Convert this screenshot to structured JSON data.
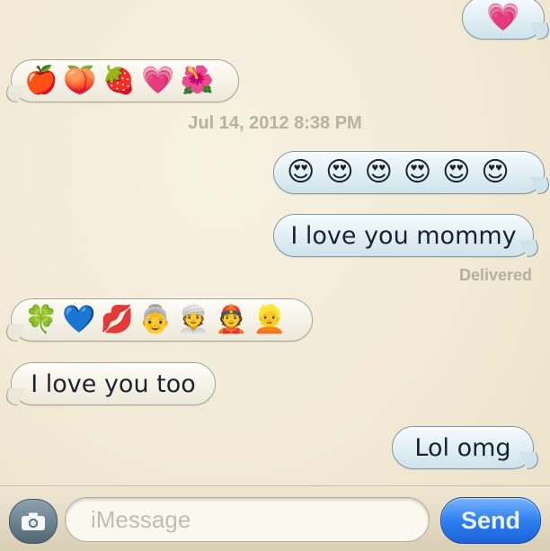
{
  "messages": [
    {
      "from": "me",
      "emojis": [
        "💗"
      ]
    },
    {
      "from": "them",
      "emojis": [
        "🍎",
        "🍑",
        "🍓",
        "💗",
        "🌺"
      ]
    },
    {
      "from": "me",
      "emojis": [
        "😍",
        "😍",
        "😍",
        "😍",
        "😍",
        "😍"
      ]
    },
    {
      "from": "me",
      "text": "I love you mommy"
    },
    {
      "from": "them",
      "emojis": [
        "🍀",
        "💙",
        "💋",
        "👵",
        "👳",
        "👲",
        "👱"
      ]
    },
    {
      "from": "them",
      "text": "I love you too"
    },
    {
      "from": "me",
      "text": "Lol omg"
    }
  ],
  "timestamp": "Jul 14, 2012 8:38 PM",
  "status": "Delivered",
  "composer": {
    "placeholder": "iMessage",
    "send_label": "Send",
    "camera_icon": "camera-icon"
  },
  "colors": {
    "background": "#f3ecd9",
    "incoming_bubble": "#f6f3e8",
    "outgoing_bubble": "#ddebf0",
    "send_button": "#2f7ff0",
    "meta_text": "#b8b2a2"
  }
}
